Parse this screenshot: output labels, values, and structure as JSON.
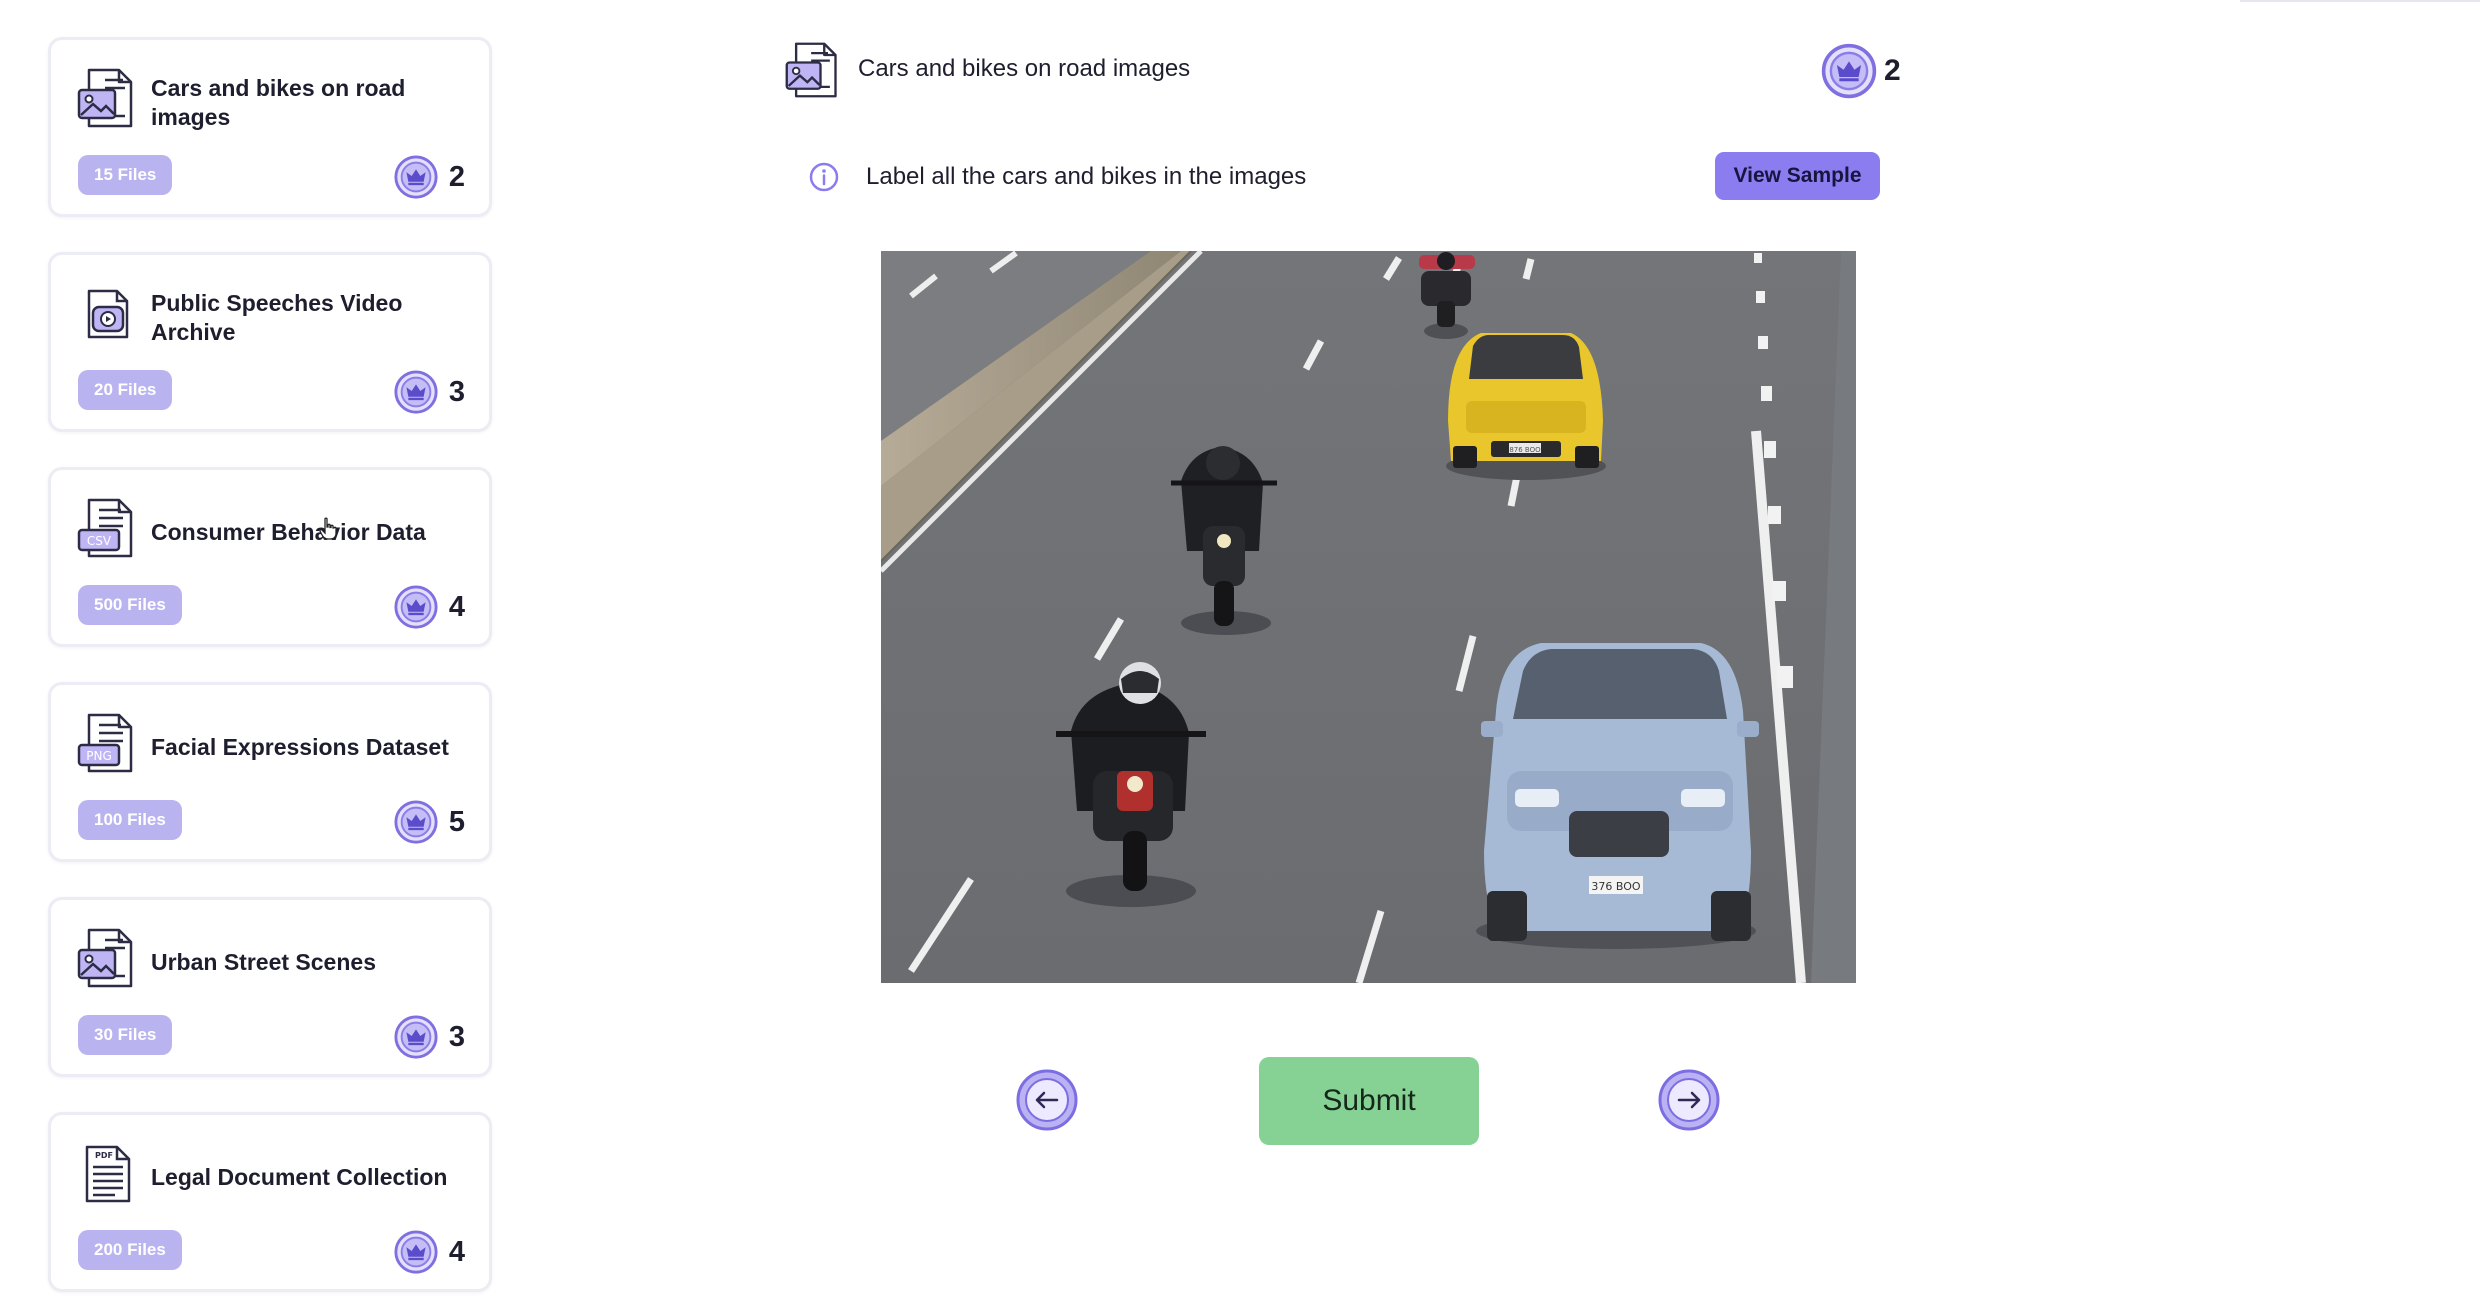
{
  "sidebar": {
    "items": [
      {
        "title": "Cars and bikes on road images",
        "files": "15 Files",
        "reward": "2",
        "icon": "image-file-icon"
      },
      {
        "title": "Public Speeches Video Archive",
        "files": "20 Files",
        "reward": "3",
        "icon": "video-file-icon"
      },
      {
        "title": "Consumer Behavior Data",
        "files": "500 Files",
        "reward": "4",
        "icon": "csv-file-icon"
      },
      {
        "title": "Facial Expressions Dataset",
        "files": "100 Files",
        "reward": "5",
        "icon": "png-file-icon"
      },
      {
        "title": "Urban Street Scenes",
        "files": "30 Files",
        "reward": "3",
        "icon": "image-file-icon"
      },
      {
        "title": "Legal Document Collection",
        "files": "200 Files",
        "reward": "4",
        "icon": "pdf-file-icon"
      }
    ]
  },
  "main": {
    "title": "Cars and bikes on road images",
    "reward": "2",
    "instruction": "Label all the cars and bikes in the images",
    "view_sample_label": "View Sample",
    "submit_label": "Submit",
    "plate_text": "376 BOO",
    "plate_text_small": "876 BOO"
  },
  "icons": {
    "csv": "CSV",
    "png": "PNG",
    "pdf": "PDF"
  },
  "colors": {
    "accent": "#8b7cf0",
    "badge": "#b9b4ef",
    "submit": "#86d294",
    "coin": "#7f6fe0"
  }
}
